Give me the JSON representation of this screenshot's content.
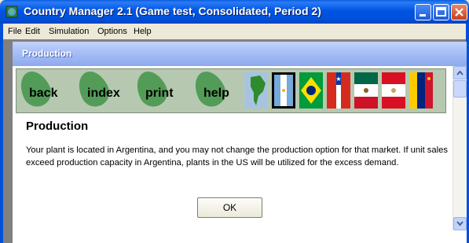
{
  "window": {
    "title": "Country Manager 2.1 (Game test, Consolidated, Period 2)",
    "icon": "globe-app-icon"
  },
  "menu": {
    "items": [
      {
        "label": "File"
      },
      {
        "label": "Edit"
      },
      {
        "label": "Simulation"
      },
      {
        "label": "Options"
      },
      {
        "label": "Help"
      }
    ]
  },
  "child_window": {
    "title": "Production"
  },
  "nav": {
    "buttons": [
      {
        "label": "back"
      },
      {
        "label": "index"
      },
      {
        "label": "print"
      },
      {
        "label": "help"
      }
    ],
    "flags": [
      "south-america-map",
      "argentina",
      "brazil",
      "chile",
      "mexico",
      "peru",
      "venezuela"
    ]
  },
  "content": {
    "heading": "Production",
    "body": "Your plant is located in Argentina, and you may not change the production option for that market.  If unit sales exceed production capacity in Argentina, plants in the US will be utilized for the excess demand.",
    "ok_label": "OK"
  },
  "colors": {
    "titlebar": "#0054e3",
    "nav_background": "#b6c9b0",
    "leaf_green": "#4e9a53"
  }
}
